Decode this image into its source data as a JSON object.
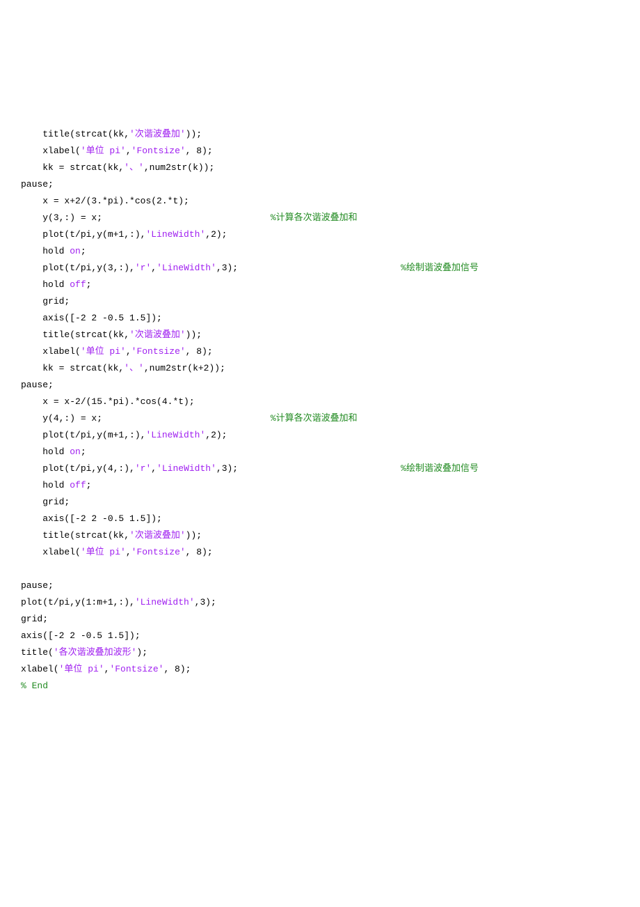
{
  "lines": [
    {
      "indent": 1,
      "segments": [
        {
          "t": "title(strcat(kk,",
          "c": ""
        },
        {
          "t": "'次谐波叠加'",
          "c": "str"
        },
        {
          "t": "));",
          "c": ""
        }
      ]
    },
    {
      "indent": 1,
      "segments": [
        {
          "t": "xlabel(",
          "c": ""
        },
        {
          "t": "'单位 pi'",
          "c": "str"
        },
        {
          "t": ",",
          "c": ""
        },
        {
          "t": "'Fontsize'",
          "c": "str"
        },
        {
          "t": ", 8);",
          "c": ""
        }
      ]
    },
    {
      "indent": 1,
      "segments": [
        {
          "t": "kk = strcat(kk,",
          "c": ""
        },
        {
          "t": "'、'",
          "c": "str"
        },
        {
          "t": ",num2str(k));",
          "c": ""
        }
      ]
    },
    {
      "indent": 0,
      "segments": [
        {
          "t": "pause;",
          "c": ""
        }
      ]
    },
    {
      "indent": 1,
      "segments": [
        {
          "t": "x = x+2/(3.*pi).*cos(2.*t);",
          "c": ""
        }
      ]
    },
    {
      "indent": 1,
      "segments": [
        {
          "t": "y(3,:) = x;                               ",
          "c": ""
        },
        {
          "t": "%计算各次谐波叠加和",
          "c": "cmt"
        }
      ]
    },
    {
      "indent": 1,
      "segments": [
        {
          "t": "plot(t/pi,y(m+1,:),",
          "c": ""
        },
        {
          "t": "'LineWidth'",
          "c": "str"
        },
        {
          "t": ",2);",
          "c": ""
        }
      ]
    },
    {
      "indent": 1,
      "segments": [
        {
          "t": "hold ",
          "c": ""
        },
        {
          "t": "on",
          "c": "str"
        },
        {
          "t": ";",
          "c": ""
        }
      ]
    },
    {
      "indent": 1,
      "segments": [
        {
          "t": "plot(t/pi,y(3,:),",
          "c": ""
        },
        {
          "t": "'r'",
          "c": "str"
        },
        {
          "t": ",",
          "c": ""
        },
        {
          "t": "'LineWidth'",
          "c": "str"
        },
        {
          "t": ",3);                              ",
          "c": ""
        },
        {
          "t": "%绘制谐波叠加信号",
          "c": "cmt"
        }
      ]
    },
    {
      "indent": 1,
      "segments": [
        {
          "t": "hold ",
          "c": ""
        },
        {
          "t": "off",
          "c": "str"
        },
        {
          "t": ";",
          "c": ""
        }
      ]
    },
    {
      "indent": 1,
      "segments": [
        {
          "t": "grid;",
          "c": ""
        }
      ]
    },
    {
      "indent": 1,
      "segments": [
        {
          "t": "axis([-2 2 -0.5 1.5]);",
          "c": ""
        }
      ]
    },
    {
      "indent": 1,
      "segments": [
        {
          "t": "title(strcat(kk,",
          "c": ""
        },
        {
          "t": "'次谐波叠加'",
          "c": "str"
        },
        {
          "t": "));",
          "c": ""
        }
      ]
    },
    {
      "indent": 1,
      "segments": [
        {
          "t": "xlabel(",
          "c": ""
        },
        {
          "t": "'单位 pi'",
          "c": "str"
        },
        {
          "t": ",",
          "c": ""
        },
        {
          "t": "'Fontsize'",
          "c": "str"
        },
        {
          "t": ", 8);",
          "c": ""
        }
      ]
    },
    {
      "indent": 1,
      "segments": [
        {
          "t": "kk = strcat(kk,",
          "c": ""
        },
        {
          "t": "'、'",
          "c": "str"
        },
        {
          "t": ",num2str(k+2));",
          "c": ""
        }
      ]
    },
    {
      "indent": 0,
      "segments": [
        {
          "t": "pause;",
          "c": ""
        }
      ]
    },
    {
      "indent": 1,
      "segments": [
        {
          "t": "x = x-2/(15.*pi).*cos(4.*t);",
          "c": ""
        }
      ]
    },
    {
      "indent": 1,
      "segments": [
        {
          "t": "y(4,:) = x;                               ",
          "c": ""
        },
        {
          "t": "%计算各次谐波叠加和",
          "c": "cmt"
        }
      ]
    },
    {
      "indent": 1,
      "segments": [
        {
          "t": "plot(t/pi,y(m+1,:),",
          "c": ""
        },
        {
          "t": "'LineWidth'",
          "c": "str"
        },
        {
          "t": ",2);",
          "c": ""
        }
      ]
    },
    {
      "indent": 1,
      "segments": [
        {
          "t": "hold ",
          "c": ""
        },
        {
          "t": "on",
          "c": "str"
        },
        {
          "t": ";",
          "c": ""
        }
      ]
    },
    {
      "indent": 1,
      "segments": [
        {
          "t": "plot(t/pi,y(4,:),",
          "c": ""
        },
        {
          "t": "'r'",
          "c": "str"
        },
        {
          "t": ",",
          "c": ""
        },
        {
          "t": "'LineWidth'",
          "c": "str"
        },
        {
          "t": ",3);                              ",
          "c": ""
        },
        {
          "t": "%绘制谐波叠加信号",
          "c": "cmt"
        }
      ]
    },
    {
      "indent": 1,
      "segments": [
        {
          "t": "hold ",
          "c": ""
        },
        {
          "t": "off",
          "c": "str"
        },
        {
          "t": ";",
          "c": ""
        }
      ]
    },
    {
      "indent": 1,
      "segments": [
        {
          "t": "grid;",
          "c": ""
        }
      ]
    },
    {
      "indent": 1,
      "segments": [
        {
          "t": "axis([-2 2 -0.5 1.5]);",
          "c": ""
        }
      ]
    },
    {
      "indent": 1,
      "segments": [
        {
          "t": "title(strcat(kk,",
          "c": ""
        },
        {
          "t": "'次谐波叠加'",
          "c": "str"
        },
        {
          "t": "));",
          "c": ""
        }
      ]
    },
    {
      "indent": 1,
      "segments": [
        {
          "t": "xlabel(",
          "c": ""
        },
        {
          "t": "'单位 pi'",
          "c": "str"
        },
        {
          "t": ",",
          "c": ""
        },
        {
          "t": "'Fontsize'",
          "c": "str"
        },
        {
          "t": ", 8);",
          "c": ""
        }
      ]
    },
    {
      "indent": 0,
      "segments": [
        {
          "t": " ",
          "c": ""
        }
      ]
    },
    {
      "indent": 0,
      "segments": [
        {
          "t": "pause;",
          "c": ""
        }
      ]
    },
    {
      "indent": 0,
      "segments": [
        {
          "t": "plot(t/pi,y(1:m+1,:),",
          "c": ""
        },
        {
          "t": "'LineWidth'",
          "c": "str"
        },
        {
          "t": ",3);",
          "c": ""
        }
      ]
    },
    {
      "indent": 0,
      "segments": [
        {
          "t": "grid;",
          "c": ""
        }
      ]
    },
    {
      "indent": 0,
      "segments": [
        {
          "t": "axis([-2 2 -0.5 1.5]);",
          "c": ""
        }
      ]
    },
    {
      "indent": 0,
      "segments": [
        {
          "t": "title(",
          "c": ""
        },
        {
          "t": "'各次谐波叠加波形'",
          "c": "str"
        },
        {
          "t": ");",
          "c": ""
        }
      ]
    },
    {
      "indent": 0,
      "segments": [
        {
          "t": "xlabel(",
          "c": ""
        },
        {
          "t": "'单位 pi'",
          "c": "str"
        },
        {
          "t": ",",
          "c": ""
        },
        {
          "t": "'Fontsize'",
          "c": "str"
        },
        {
          "t": ", 8);",
          "c": ""
        }
      ]
    },
    {
      "indent": 0,
      "segments": [
        {
          "t": "% End",
          "c": "cmt"
        }
      ]
    }
  ],
  "indentUnit": "    "
}
